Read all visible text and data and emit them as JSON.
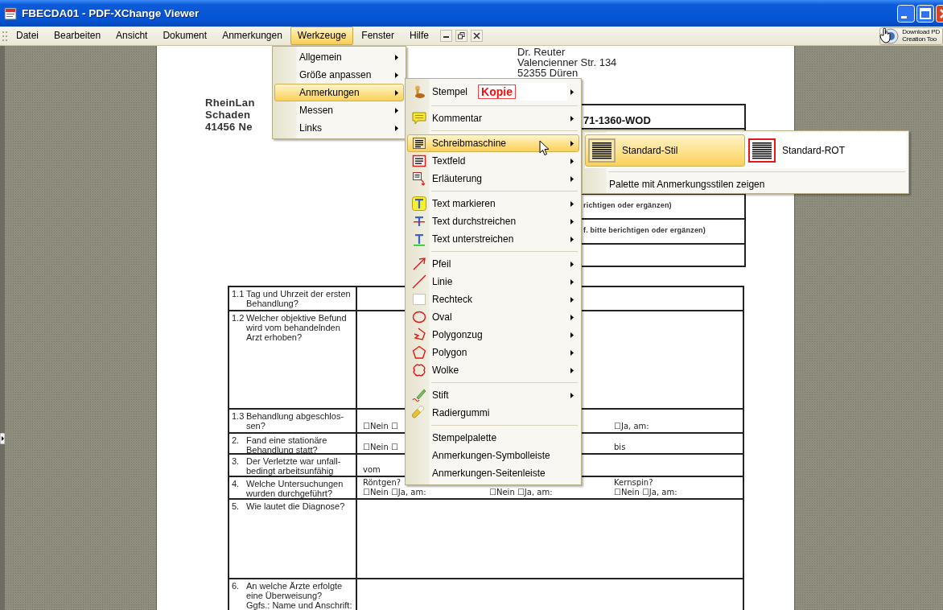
{
  "window": {
    "title": "FBECDA01 - PDF-XChange Viewer"
  },
  "menubar": {
    "items": [
      {
        "label": "Datei",
        "selected": false
      },
      {
        "label": "Bearbeiten",
        "selected": false
      },
      {
        "label": "Ansicht",
        "selected": false
      },
      {
        "label": "Dokument",
        "selected": false
      },
      {
        "label": "Anmerkungen",
        "selected": false
      },
      {
        "label": "Werkzeuge",
        "selected": true
      },
      {
        "label": "Fenster",
        "selected": false
      },
      {
        "label": "Hilfe",
        "selected": false
      }
    ],
    "download_button": {
      "lines": [
        "Download PD",
        "Creation Too"
      ]
    }
  },
  "document": {
    "recipient_lines": [
      "Dr. Reuter",
      "Valencienner Str. 134",
      "52355 Düren"
    ],
    "sender_lines": [
      "RheinLan",
      "Schaden",
      "41456 Ne"
    ],
    "reference": "71-1360-WOD",
    "notes": [
      "richtigen oder ergänzen)",
      "f. bitte berichtigen oder ergänzen)"
    ],
    "questions": [
      {
        "number": "1.1",
        "lines": [
          "Tag und Uhrzeit der ersten",
          "Behandlung?"
        ]
      },
      {
        "number": "1.2",
        "lines": [
          "Welcher objektive Befund",
          "wird vom behandelnden",
          "Arzt erhoben?"
        ]
      },
      {
        "number": "1.3",
        "lines": [
          "Behandlung abgeschlos-",
          "sen?"
        ],
        "answer_left": [
          "☐Nein ☐"
        ],
        "answer_right": [
          "☐Ja, am:"
        ]
      },
      {
        "number": "2.",
        "lines": [
          "Fand eine stationäre",
          "Behandlung statt?"
        ],
        "answer_left": [
          "☐Nein ☐"
        ],
        "answer_right": [
          "bis"
        ]
      },
      {
        "number": "3.",
        "lines": [
          "Der Verletzte war unfall-",
          "bedingt arbeitsunfähig"
        ],
        "answer_left": [
          "vom"
        ]
      },
      {
        "number": "4.",
        "lines": [
          "Welche Untersuchungen",
          "wurden durchgeführt?"
        ],
        "answer_left": [
          "Röntgen?",
          "☐Nein ☐Ja, am:"
        ],
        "answer_middle": [
          "☐Nein ☐Ja, am:"
        ],
        "answer_right": [
          "Kernspin?",
          "☐Nein ☐Ja, am:"
        ]
      },
      {
        "number": "5.",
        "lines": [
          "Wie lautet die Diagnose?"
        ]
      },
      {
        "number": "6.",
        "lines": [
          "An welche Ärzte erfolgte",
          "eine Überweisung?",
          "Ggfs.: Name und Anschrift:"
        ]
      }
    ]
  },
  "werkzeuge_menu": {
    "items": [
      {
        "label": "Allgemein",
        "has_submenu": true,
        "selected": false
      },
      {
        "label": "Größe anpassen",
        "has_submenu": true,
        "selected": false
      },
      {
        "label": "Anmerkungen",
        "has_submenu": true,
        "selected": true
      },
      {
        "label": "Messen",
        "has_submenu": true,
        "selected": false
      },
      {
        "label": "Links",
        "has_submenu": true,
        "selected": false
      }
    ]
  },
  "anmerkungen_submenu": {
    "items": [
      {
        "kind": "stamp",
        "label": "Stempel",
        "stamp": "Kopie",
        "has_submenu": true,
        "selected": false
      },
      {
        "kind": "separator"
      },
      {
        "kind": "item",
        "label": "Kommentar",
        "has_submenu": true,
        "selected": false
      },
      {
        "kind": "separator"
      },
      {
        "kind": "item",
        "label": "Schreibmaschine",
        "has_submenu": true,
        "selected": true
      },
      {
        "kind": "item",
        "label": "Textfeld",
        "has_submenu": true,
        "selected": false
      },
      {
        "kind": "item",
        "label": "Erläuterung",
        "has_submenu": true,
        "selected": false
      },
      {
        "kind": "separator"
      },
      {
        "kind": "item",
        "label": "Text markieren",
        "has_submenu": true,
        "selected": false
      },
      {
        "kind": "item",
        "label": "Text durchstreichen",
        "has_submenu": true,
        "selected": false
      },
      {
        "kind": "item",
        "label": "Text unterstreichen",
        "has_submenu": true,
        "selected": false
      },
      {
        "kind": "separator"
      },
      {
        "kind": "item",
        "label": "Pfeil",
        "has_submenu": true,
        "selected": false
      },
      {
        "kind": "item",
        "label": "Linie",
        "has_submenu": true,
        "selected": false
      },
      {
        "kind": "item",
        "label": "Rechteck",
        "has_submenu": true,
        "selected": false
      },
      {
        "kind": "item",
        "label": "Oval",
        "has_submenu": true,
        "selected": false
      },
      {
        "kind": "item",
        "label": "Polygonzug",
        "has_submenu": true,
        "selected": false
      },
      {
        "kind": "item",
        "label": "Polygon",
        "has_submenu": true,
        "selected": false
      },
      {
        "kind": "item",
        "label": "Wolke",
        "has_submenu": true,
        "selected": false
      },
      {
        "kind": "separator"
      },
      {
        "kind": "item",
        "label": "Stift",
        "has_submenu": true,
        "selected": false
      },
      {
        "kind": "item",
        "label": "Radiergummi",
        "has_submenu": false,
        "selected": false
      },
      {
        "kind": "separator"
      },
      {
        "kind": "item",
        "label": "Stempelpalette",
        "has_submenu": false,
        "selected": false
      },
      {
        "kind": "item",
        "label": "Anmerkungen-Symbolleiste",
        "has_submenu": false,
        "selected": false
      },
      {
        "kind": "item",
        "label": "Anmerkungen-Seitenleiste",
        "has_submenu": false,
        "selected": false
      }
    ]
  },
  "style_submenu": {
    "styles": [
      {
        "label": "Standard-Stil",
        "selected": true,
        "color": "#b5aa88"
      },
      {
        "label": "Standard-ROT",
        "selected": false,
        "color": "#e01818"
      }
    ],
    "actions": [
      "Palette mit Anmerkungsstilen zeigen"
    ]
  }
}
